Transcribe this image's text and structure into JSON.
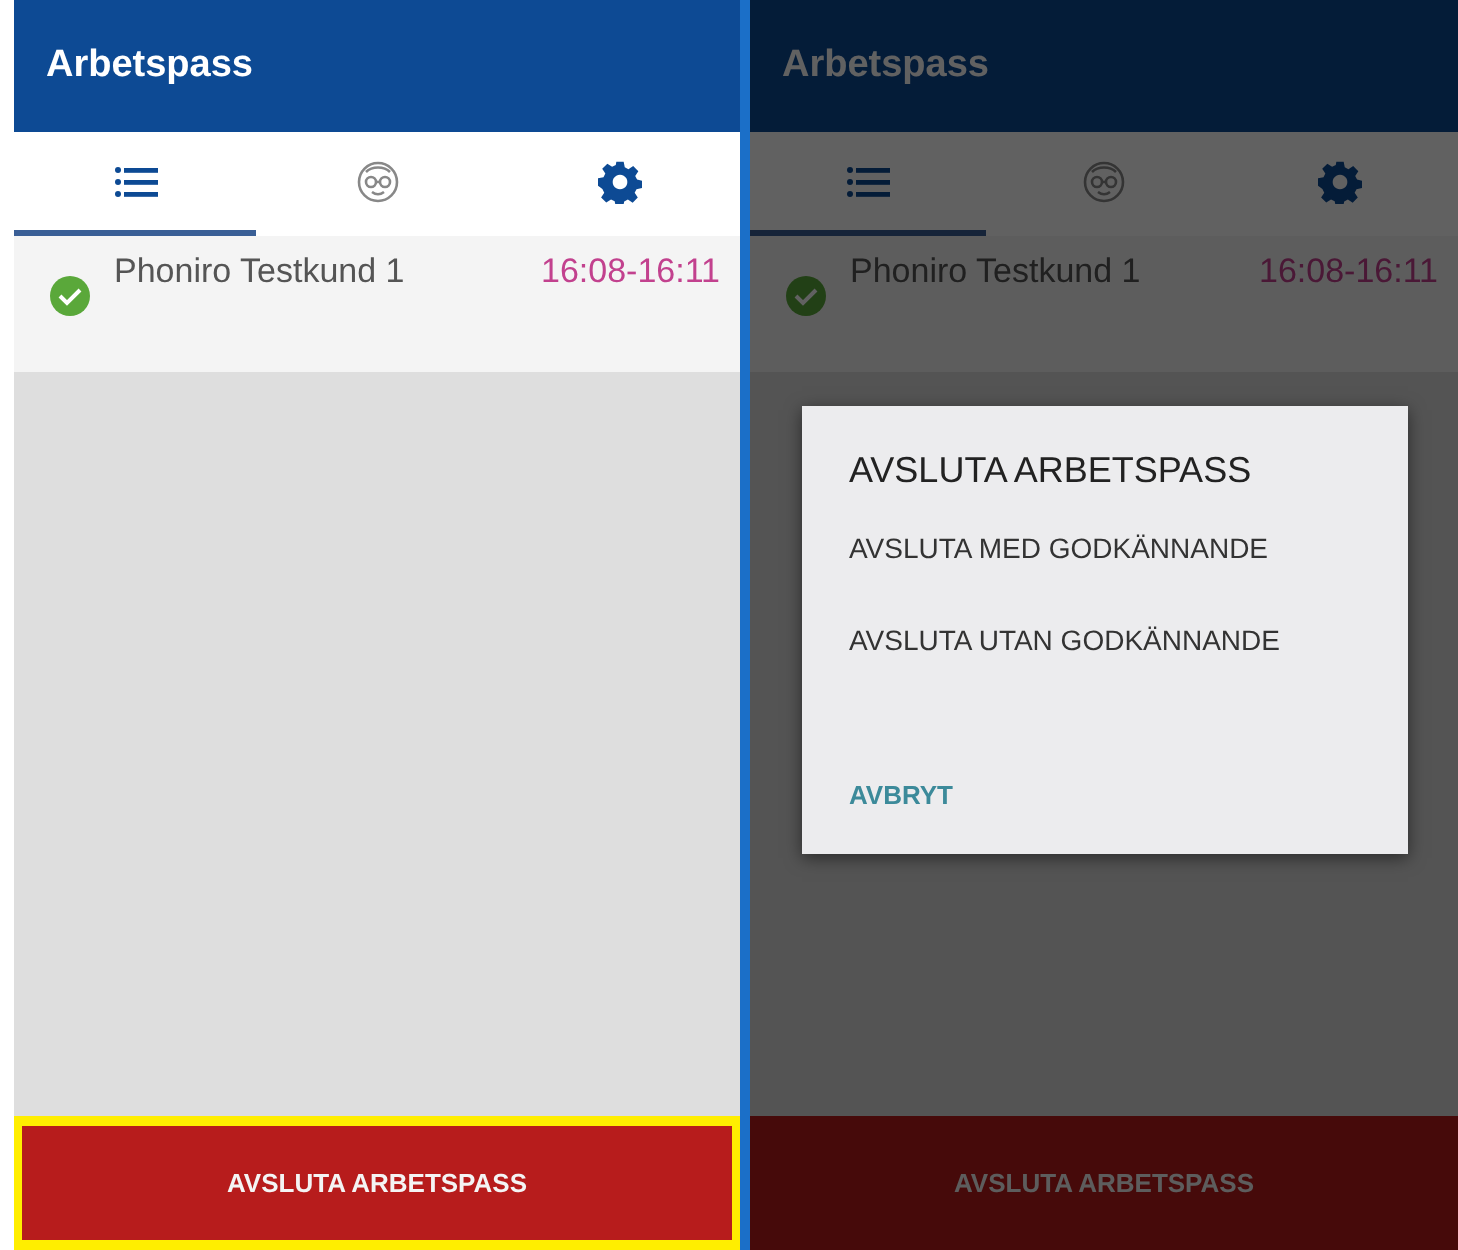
{
  "screens": [
    {
      "title": "Arbetspass",
      "dimmed": false,
      "tabs": [
        {
          "kind": "list",
          "selected": true
        },
        {
          "kind": "face",
          "selected": false
        },
        {
          "kind": "gear",
          "selected": false
        }
      ],
      "rows": [
        {
          "name": "Phoniro Testkund 1",
          "time": "16:08-16:11",
          "done": true
        }
      ],
      "button": {
        "label": "AVSLUTA ARBETSPASS",
        "highlighted": true
      }
    },
    {
      "title": "Arbetspass",
      "dimmed": true,
      "tabs": [
        {
          "kind": "list",
          "selected": true
        },
        {
          "kind": "face",
          "selected": false
        },
        {
          "kind": "gear",
          "selected": false
        }
      ],
      "rows": [
        {
          "name": "Phoniro Testkund 1",
          "time": "16:08-16:11",
          "done": true
        }
      ],
      "button": {
        "label": "AVSLUTA ARBETSPASS",
        "highlighted": false
      },
      "dialog": {
        "title": "AVSLUTA ARBETSPASS",
        "options": [
          "AVSLUTA MED GODKÄNNANDE",
          "AVSLUTA UTAN GODKÄNNANDE"
        ],
        "cancel": "AVBRYT"
      }
    }
  ]
}
